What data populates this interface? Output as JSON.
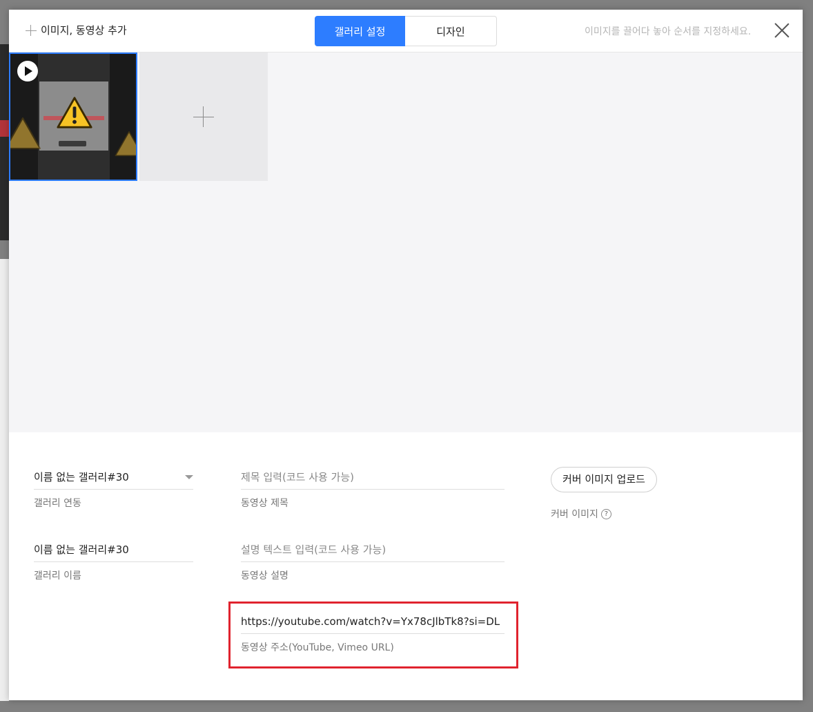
{
  "header": {
    "add_label": "이미지, 동영상 추가",
    "tabs": [
      {
        "label": "갤러리 설정",
        "active": true
      },
      {
        "label": "디자인",
        "active": false
      }
    ],
    "hint": "이미지를 끌어다 놓아 순서를 지정하세요."
  },
  "gallery": {
    "items": [
      {
        "type": "video",
        "selected": true
      }
    ],
    "accent": "#2d7dff"
  },
  "form": {
    "gallery_link": {
      "value": "이름 없는 갤러리#30",
      "caption": "갤러리 연동"
    },
    "gallery_name": {
      "value": "이름 없는 갤러리#30",
      "caption": "갤러리 이름"
    },
    "video_title": {
      "placeholder": "제목 입력(코드 사용 가능)",
      "caption": "동영상 제목"
    },
    "video_desc": {
      "placeholder": "설명 텍스트 입력(코드 사용 가능)",
      "caption": "동영상 설명"
    },
    "video_url": {
      "value": "https://youtube.com/watch?v=Yx78cJlbTk8?si=DL",
      "caption": "동영상 주소(YouTube, Vimeo URL)"
    },
    "cover": {
      "button": "커버 이미지 업로드",
      "caption": "커버 이미지"
    }
  },
  "highlight_color": "#e0232e"
}
